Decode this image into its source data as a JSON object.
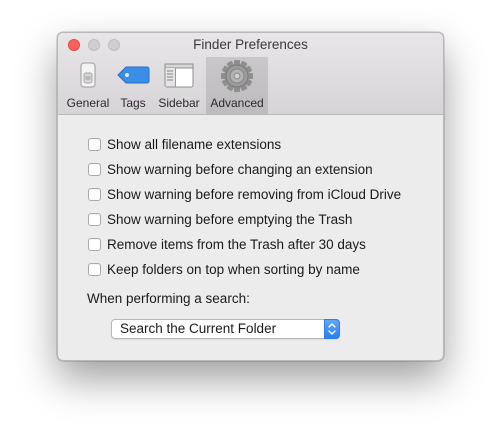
{
  "window": {
    "title": "Finder Preferences"
  },
  "toolbar": {
    "tabs": [
      {
        "label": "General",
        "icon": "general-switch-icon"
      },
      {
        "label": "Tags",
        "icon": "tag-icon"
      },
      {
        "label": "Sidebar",
        "icon": "sidebar-icon"
      },
      {
        "label": "Advanced",
        "icon": "gear-icon"
      }
    ],
    "selected": "Advanced"
  },
  "options": [
    {
      "label": "Show all filename extensions",
      "checked": false
    },
    {
      "label": "Show warning before changing an extension",
      "checked": false
    },
    {
      "label": "Show warning before removing from iCloud Drive",
      "checked": false
    },
    {
      "label": "Show warning before emptying the Trash",
      "checked": false
    },
    {
      "label": "Remove items from the Trash after 30 days",
      "checked": false
    },
    {
      "label": "Keep folders on top when sorting by name",
      "checked": false
    }
  ],
  "search": {
    "label": "When performing a search:",
    "selected": "Search the Current Folder"
  },
  "colors": {
    "accent": "#2a80f2",
    "close": "#fc605c"
  }
}
